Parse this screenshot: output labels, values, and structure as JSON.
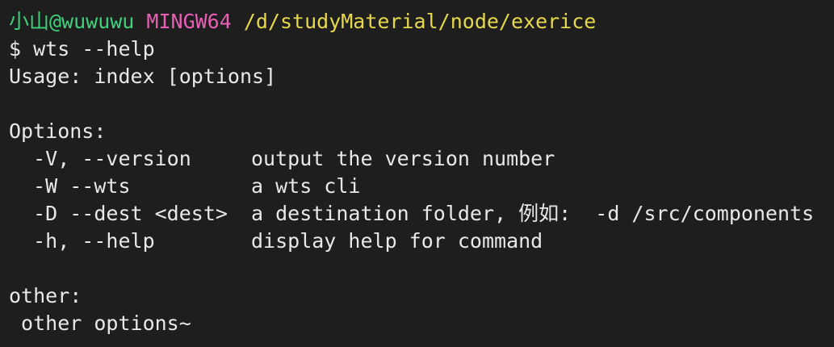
{
  "prompt": {
    "user_host": "小山@wuwuwu",
    "shell": "MINGW64",
    "path": "/d/studyMaterial/node/exerice",
    "symbol": "$",
    "command": "wts --help"
  },
  "output": {
    "usage": "Usage: index [options]",
    "options_header": "Options:",
    "options": [
      {
        "flag": "  -V, --version",
        "desc": "output the version number"
      },
      {
        "flag": "  -W --wts",
        "desc": "a wts cli"
      },
      {
        "flag": "  -D --dest <dest>",
        "desc": "a destination folder, 例如:  -d /src/components"
      },
      {
        "flag": "  -h, --help",
        "desc": "display help for command"
      }
    ],
    "other_header": "other:",
    "other_text": " other options~"
  },
  "colors": {
    "background": "#1e1e1e",
    "user": "#3fd17a",
    "shell": "#e860b6",
    "path": "#e6d84a",
    "text": "#e8e8e8"
  }
}
